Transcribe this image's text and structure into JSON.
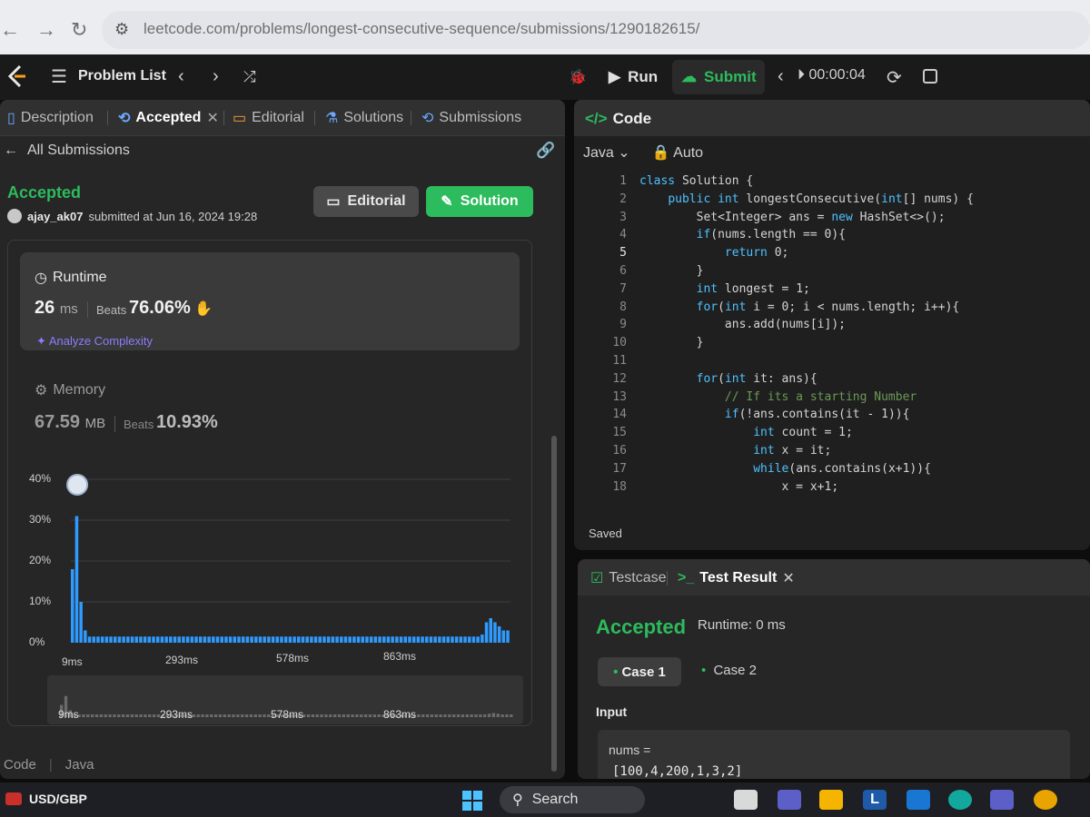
{
  "browser": {
    "url": "leetcode.com/problems/longest-consecutive-sequence/submissions/1290182615/"
  },
  "header": {
    "problem_list": "Problem List",
    "run": "Run",
    "submit": "Submit",
    "timer": "00:00:04"
  },
  "left_tabs": [
    {
      "label": "Description"
    },
    {
      "label": "Accepted"
    },
    {
      "label": "Editorial"
    },
    {
      "label": "Solutions"
    },
    {
      "label": "Submissions"
    }
  ],
  "submission": {
    "back_label": "All Submissions",
    "status": "Accepted",
    "user": "ajay_ak07",
    "submitted_text": "submitted at Jun 16, 2024 19:28",
    "editorial_button": "Editorial",
    "solution_button": "Solution"
  },
  "runtime": {
    "title": "Runtime",
    "value": "26",
    "unit": "ms",
    "beats_label": "Beats",
    "beats": "76.06%",
    "analyze": "Analyze Complexity"
  },
  "memory": {
    "title": "Memory",
    "value": "67.59",
    "unit": "MB",
    "beats_label": "Beats",
    "beats": "10.93%"
  },
  "chart_data": {
    "type": "bar",
    "yticks": [
      "40%",
      "30%",
      "20%",
      "10%",
      "0%"
    ],
    "xticks": [
      "9ms",
      "293ms",
      "578ms",
      "863ms"
    ],
    "ylim": [
      0,
      40
    ],
    "highlighted_bar": 2,
    "values": [
      18,
      31,
      10,
      3,
      1.5,
      1.5,
      1.5,
      1.5,
      1.5,
      1.5,
      1.5,
      1.5,
      1.5,
      1.5,
      1.5,
      1.5,
      1.5,
      1.5,
      1.5,
      1.5,
      1.5,
      1.5,
      1.5,
      1.5,
      1.5,
      1.5,
      1.5,
      1.5,
      1.5,
      1.5,
      1.5,
      1.5,
      1.5,
      1.5,
      1.5,
      1.5,
      1.5,
      1.5,
      1.5,
      1.5,
      1.5,
      1.5,
      1.5,
      1.5,
      1.5,
      1.5,
      1.5,
      1.5,
      1.5,
      1.5,
      1.5,
      1.5,
      1.5,
      1.5,
      1.5,
      1.5,
      1.5,
      1.5,
      1.5,
      1.5,
      1.5,
      1.5,
      1.5,
      1.5,
      1.5,
      1.5,
      1.5,
      1.5,
      1.5,
      1.5,
      1.5,
      1.5,
      1.5,
      1.5,
      1.5,
      1.5,
      1.5,
      1.5,
      1.5,
      1.5,
      1.5,
      1.5,
      1.5,
      1.5,
      1.5,
      1.5,
      1.5,
      1.5,
      1.5,
      1.5,
      1.5,
      1.5,
      1.5,
      1.5,
      1.5,
      1.5,
      2,
      5,
      6,
      5,
      4,
      3,
      3
    ],
    "mini_xticks": [
      "9ms",
      "293ms",
      "578ms",
      "863ms"
    ]
  },
  "bottom_tabs": [
    "Code",
    "Java"
  ],
  "code_panel": {
    "title": "Code",
    "language": "Java",
    "auto": "Auto",
    "saved": "Saved",
    "lines": [
      "class Solution {",
      "    public int longestConsecutive(int[] nums) {",
      "        Set<Integer> ans = new HashSet<>();",
      "        if(nums.length == 0){",
      "            return 0;",
      "        }",
      "        int longest = 1;",
      "        for(int i = 0; i < nums.length; i++){",
      "            ans.add(nums[i]);",
      "        }",
      "",
      "        for(int it: ans){",
      "            // If its a starting Number",
      "            if(!ans.contains(it - 1)){",
      "                int count = 1;",
      "                int x = it;",
      "                while(ans.contains(x+1)){",
      "                    x = x+1;"
    ]
  },
  "test_panel": {
    "tab_testcase": "Testcase",
    "tab_result": "Test Result",
    "status": "Accepted",
    "runtime": "Runtime: 0 ms",
    "case1": "Case 1",
    "case2": "Case 2",
    "input_label": "Input",
    "var_name": "nums =",
    "var_value": "[100,4,200,1,3,2]"
  },
  "taskbar": {
    "ticker": "USD/GBP",
    "search": "Search"
  },
  "colors": {
    "accent_green": "#2cbb5d",
    "bar_blue": "#2f9bff",
    "bg": "#262626"
  }
}
